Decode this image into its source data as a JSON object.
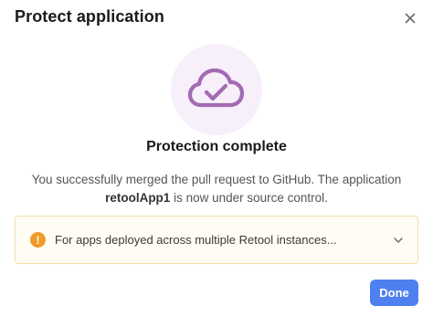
{
  "dialog": {
    "title": "Protect application",
    "close_icon": "close-icon"
  },
  "hero": {
    "icon": "cloud-check-icon",
    "accent_color": "#a36bb4",
    "circle_color": "#f7eff9"
  },
  "status": {
    "heading": "Protection complete",
    "message_before": "You successfully merged the pull request to GitHub. The application ",
    "app_name": "retoolApp1",
    "message_after": " is now under source control."
  },
  "alert": {
    "icon": "warning-icon",
    "icon_glyph": "!",
    "icon_color": "#ef9b2c",
    "text": "For apps deployed across multiple Retool instances...",
    "chevron_icon": "chevron-down-icon"
  },
  "footer": {
    "done_label": "Done",
    "button_color": "#4f80f0"
  }
}
